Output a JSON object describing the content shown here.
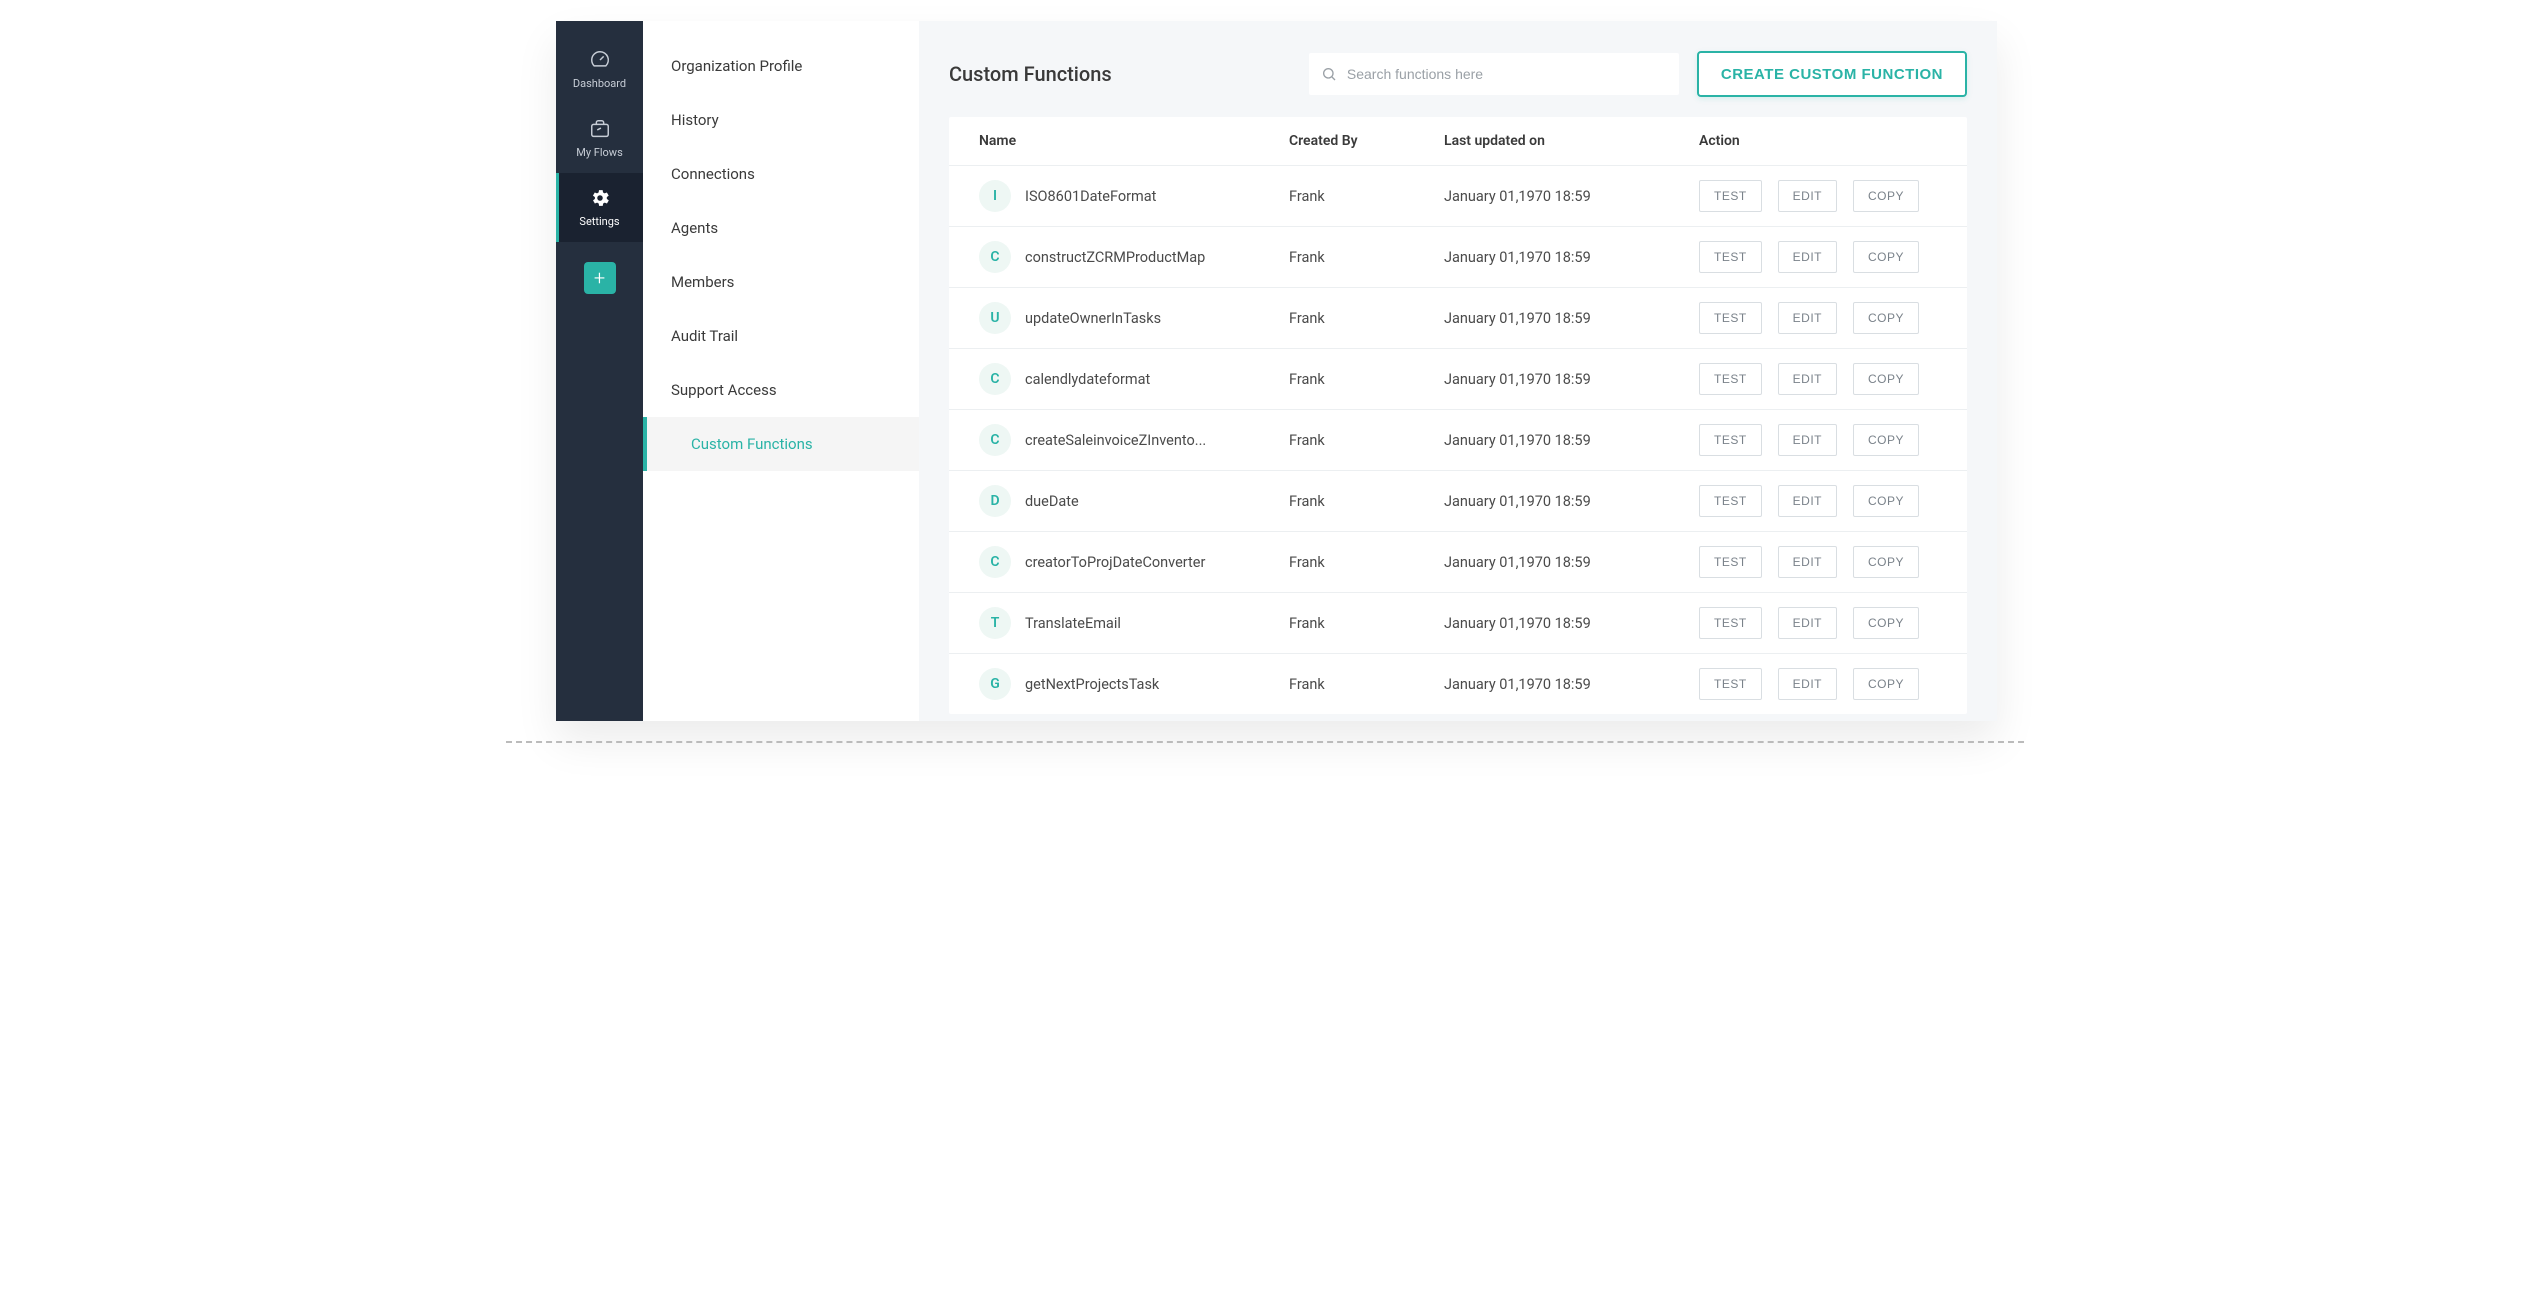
{
  "rail": {
    "dashboard": "Dashboard",
    "myflows": "My Flows",
    "settings": "Settings"
  },
  "side_items": [
    "Organization Profile",
    "History",
    "Connections",
    "Agents",
    "Members",
    "Audit Trail",
    "Support Access",
    "Custom Functions"
  ],
  "side_active_index": 7,
  "main": {
    "title": "Custom Functions",
    "search_placeholder": "Search functions here",
    "create_label": "CREATE CUSTOM FUNCTION"
  },
  "columns": {
    "name": "Name",
    "created_by": "Created By",
    "updated": "Last updated on",
    "action": "Action"
  },
  "action_labels": {
    "test": "TEST",
    "edit": "EDIT",
    "copy": "COPY"
  },
  "rows": [
    {
      "avatar": "I",
      "name": "ISO8601DateFormat",
      "created_by": "Frank",
      "updated": "January 01,1970 18:59"
    },
    {
      "avatar": "C",
      "name": "constructZCRMProductMap",
      "created_by": "Frank",
      "updated": "January 01,1970 18:59"
    },
    {
      "avatar": "U",
      "name": "updateOwnerInTasks",
      "created_by": "Frank",
      "updated": "January 01,1970 18:59"
    },
    {
      "avatar": "C",
      "name": "calendlydateformat",
      "created_by": "Frank",
      "updated": "January 01,1970 18:59"
    },
    {
      "avatar": "C",
      "name": "createSaleinvoiceZInvento...",
      "created_by": "Frank",
      "updated": "January 01,1970 18:59"
    },
    {
      "avatar": "D",
      "name": "dueDate",
      "created_by": "Frank",
      "updated": "January 01,1970 18:59"
    },
    {
      "avatar": "C",
      "name": "creatorToProjDateConverter",
      "created_by": "Frank",
      "updated": "January 01,1970 18:59"
    },
    {
      "avatar": "T",
      "name": "TranslateEmail",
      "created_by": "Frank",
      "updated": "January 01,1970 18:59"
    },
    {
      "avatar": "G",
      "name": "getNextProjectsTask",
      "created_by": "Frank",
      "updated": "January 01,1970 18:59"
    }
  ]
}
